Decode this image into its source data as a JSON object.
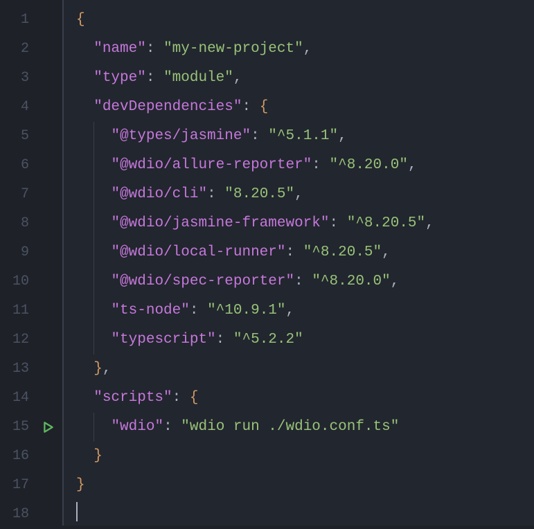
{
  "lineNumbers": [
    "1",
    "2",
    "3",
    "4",
    "5",
    "6",
    "7",
    "8",
    "9",
    "10",
    "11",
    "12",
    "13",
    "14",
    "15",
    "16",
    "17",
    "18"
  ],
  "runRow": 15,
  "tokens": {
    "brace_open": "{",
    "brace_close": "}",
    "colon": ":",
    "comma": ",",
    "k_name": "\"name\"",
    "v_name": "\"my-new-project\"",
    "k_type": "\"type\"",
    "v_type": "\"module\"",
    "k_devdeps": "\"devDependencies\"",
    "k_dep1": "\"@types/jasmine\"",
    "v_dep1": "\"^5.1.1\"",
    "k_dep2": "\"@wdio/allure-reporter\"",
    "v_dep2": "\"^8.20.0\"",
    "k_dep3": "\"@wdio/cli\"",
    "v_dep3": "\"8.20.5\"",
    "k_dep4": "\"@wdio/jasmine-framework\"",
    "v_dep4": "\"^8.20.5\"",
    "k_dep5": "\"@wdio/local-runner\"",
    "v_dep5": "\"^8.20.5\"",
    "k_dep6": "\"@wdio/spec-reporter\"",
    "v_dep6": "\"^8.20.0\"",
    "k_dep7": "\"ts-node\"",
    "v_dep7": "\"^10.9.1\"",
    "k_dep8": "\"typescript\"",
    "v_dep8": "\"^5.2.2\"",
    "k_scripts": "\"scripts\"",
    "k_wdio": "\"wdio\"",
    "v_wdio": "\"wdio run ./wdio.conf.ts\""
  }
}
